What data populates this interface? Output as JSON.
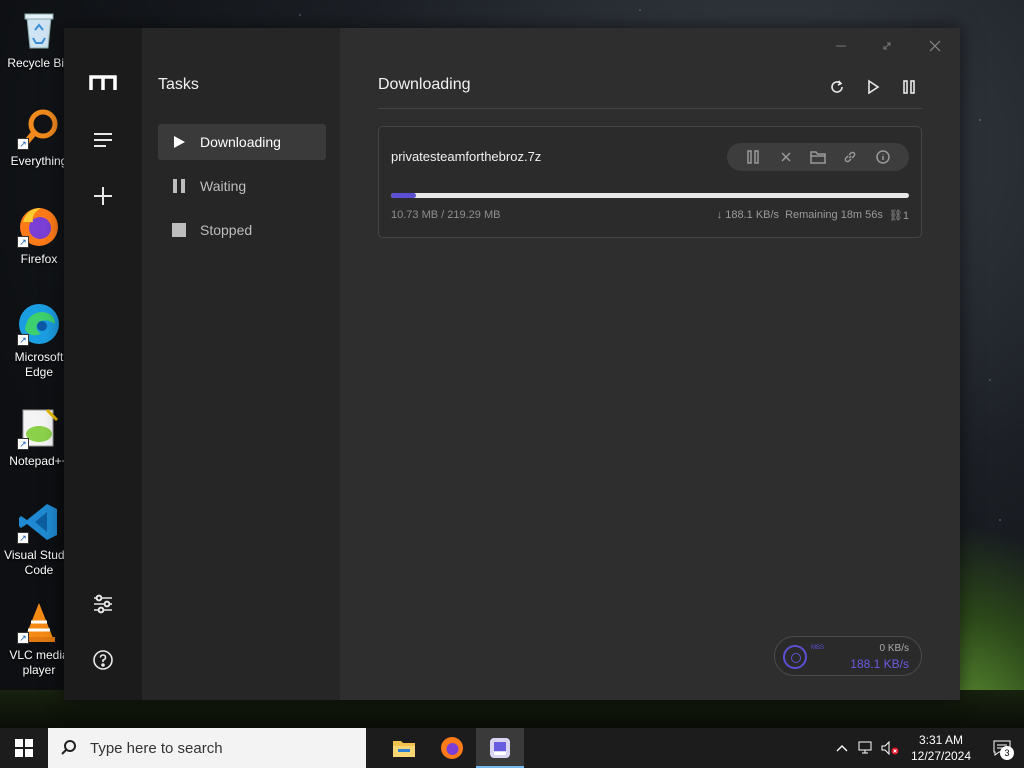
{
  "desktop": {
    "icons": [
      {
        "label": "Recycle Bin",
        "icon": "recycle-bin-icon"
      },
      {
        "label": "Everything",
        "icon": "everything-search-icon"
      },
      {
        "label": "Firefox",
        "icon": "firefox-icon"
      },
      {
        "label": "Microsoft Edge",
        "icon": "edge-icon"
      },
      {
        "label": "Notepad++",
        "icon": "notepad-plus-plus-icon"
      },
      {
        "label": "Visual Studio Code",
        "icon": "vscode-icon"
      },
      {
        "label": "VLC media player",
        "icon": "vlc-icon"
      }
    ]
  },
  "app": {
    "nav": {
      "title": "Tasks",
      "items": [
        {
          "label": "Downloading",
          "icon": "play-icon",
          "active": true
        },
        {
          "label": "Waiting",
          "icon": "pause-icon",
          "active": false
        },
        {
          "label": "Stopped",
          "icon": "stop-icon",
          "active": false
        }
      ]
    },
    "main": {
      "title": "Downloading",
      "task": {
        "filename": "privatesteamforthebroz.7z",
        "size_progress": "10.73 MB / 219.29 MB",
        "speed": "↓ 188.1 KB/s",
        "remaining": "Remaining 18m 56s",
        "connections": "1",
        "progress_fraction": 0.049
      },
      "speed_widget": {
        "upload": "0 KB/s",
        "download": "188.1 KB/s",
        "mini_label": "MBS"
      }
    },
    "accent_color": "#5b4fd4"
  },
  "taskbar": {
    "search_placeholder": "Type here to search",
    "clock_time": "3:31 AM",
    "clock_date": "12/27/2024",
    "notification_count": "3"
  }
}
